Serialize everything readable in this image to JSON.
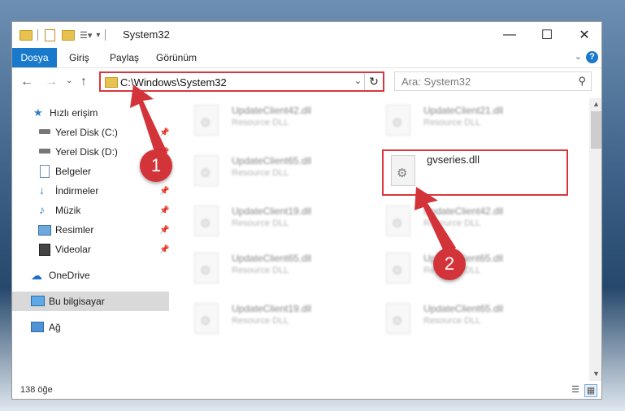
{
  "window": {
    "title": "System32",
    "controls": {
      "minimize": "—",
      "maximize": "☐",
      "close": "✕"
    }
  },
  "ribbon": {
    "file_tab": "Dosya",
    "tabs": [
      "Giriş",
      "Paylaş",
      "Görünüm"
    ],
    "help": "?"
  },
  "address_bar": {
    "path": "C:\\Windows\\System32",
    "refresh": "↻"
  },
  "search": {
    "placeholder": "Ara: System32"
  },
  "nav_pane": {
    "items": [
      {
        "label": "Hızlı erişim",
        "icon": "star-icon"
      },
      {
        "label": "Yerel Disk (C:)",
        "icon": "drive-icon",
        "pinned": true
      },
      {
        "label": "Yerel Disk (D:)",
        "icon": "drive-icon",
        "pinned": true
      },
      {
        "label": "Belgeler",
        "icon": "document-icon",
        "pinned": true
      },
      {
        "label": "İndirmeler",
        "icon": "download-icon",
        "pinned": true
      },
      {
        "label": "Müzik",
        "icon": "music-icon",
        "pinned": true
      },
      {
        "label": "Resimler",
        "icon": "picture-icon",
        "pinned": true
      },
      {
        "label": "Videolar",
        "icon": "video-icon",
        "pinned": true
      },
      {
        "label": "OneDrive",
        "icon": "cloud-icon"
      },
      {
        "label": "Bu bilgisayar",
        "icon": "computer-icon",
        "selected": true
      },
      {
        "label": "Ağ",
        "icon": "network-icon"
      }
    ]
  },
  "files": [
    {
      "name": "UpdateClient42.dll",
      "type": "Resource DLL"
    },
    {
      "name": "UpdateClient21.dll",
      "type": "Resource DLL"
    },
    {
      "name": "UpdateClient65.dll",
      "type": "Resource DLL"
    },
    {
      "name": "gvseries.dll",
      "type": ""
    },
    {
      "name": "UpdateClient19.dll",
      "type": "Resource DLL"
    },
    {
      "name": "UpdateClient42.dll",
      "type": "Resource DLL"
    },
    {
      "name": "UpdateClient65.dll",
      "type": "Resource DLL"
    },
    {
      "name": "UpdateClient65.dll",
      "type": "Resource DLL"
    },
    {
      "name": "UpdateClient19.dll",
      "type": "Resource DLL"
    },
    {
      "name": "UpdateClient65.dll",
      "type": "Resource DLL"
    }
  ],
  "status": {
    "item_count": "138 öğe"
  },
  "annotations": {
    "step1": "1",
    "step2": "2",
    "color": "#d3343a"
  }
}
